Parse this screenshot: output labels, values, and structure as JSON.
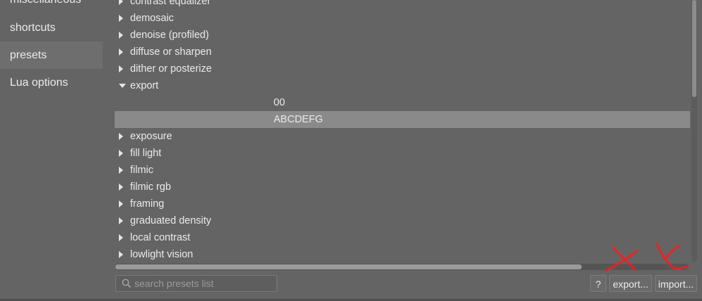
{
  "sidebar": {
    "items": [
      {
        "label": "miscellaneous",
        "active": false
      },
      {
        "label": "shortcuts",
        "active": false
      },
      {
        "label": "presets",
        "active": true
      },
      {
        "label": "Lua options",
        "active": false
      }
    ]
  },
  "presets_list": {
    "rows": [
      {
        "label": "contrast equalizer",
        "kind": "group",
        "expanded": false
      },
      {
        "label": "demosaic",
        "kind": "group",
        "expanded": false
      },
      {
        "label": "denoise (profiled)",
        "kind": "group",
        "expanded": false
      },
      {
        "label": "diffuse or sharpen",
        "kind": "group",
        "expanded": false
      },
      {
        "label": "dither or posterize",
        "kind": "group",
        "expanded": false
      },
      {
        "label": "export",
        "kind": "group",
        "expanded": true
      },
      {
        "label": "00",
        "kind": "child",
        "selected": false
      },
      {
        "label": "ABCDEFG",
        "kind": "child",
        "selected": true
      },
      {
        "label": "exposure",
        "kind": "group",
        "expanded": false
      },
      {
        "label": "fill light",
        "kind": "group",
        "expanded": false
      },
      {
        "label": "filmic",
        "kind": "group",
        "expanded": false
      },
      {
        "label": "filmic rgb",
        "kind": "group",
        "expanded": false
      },
      {
        "label": "framing",
        "kind": "group",
        "expanded": false
      },
      {
        "label": "graduated density",
        "kind": "group",
        "expanded": false
      },
      {
        "label": "local contrast",
        "kind": "group",
        "expanded": false
      },
      {
        "label": "lowlight vision",
        "kind": "group",
        "expanded": false
      }
    ],
    "horizontal_scroll_fraction": 0.81,
    "vertical_scroll_fraction": 0.37
  },
  "search": {
    "placeholder": "search presets list",
    "value": "",
    "icon": "search-icon"
  },
  "buttons": {
    "help_label": "?",
    "export_label": "export...",
    "import_label": "import..."
  },
  "annotations": {
    "color": "#ff1a1a",
    "marks": [
      "cross-mark",
      "check-mark"
    ]
  },
  "colors": {
    "background": "#646464",
    "selected_row": "#8a8a8a",
    "text": "#ebebeb"
  }
}
